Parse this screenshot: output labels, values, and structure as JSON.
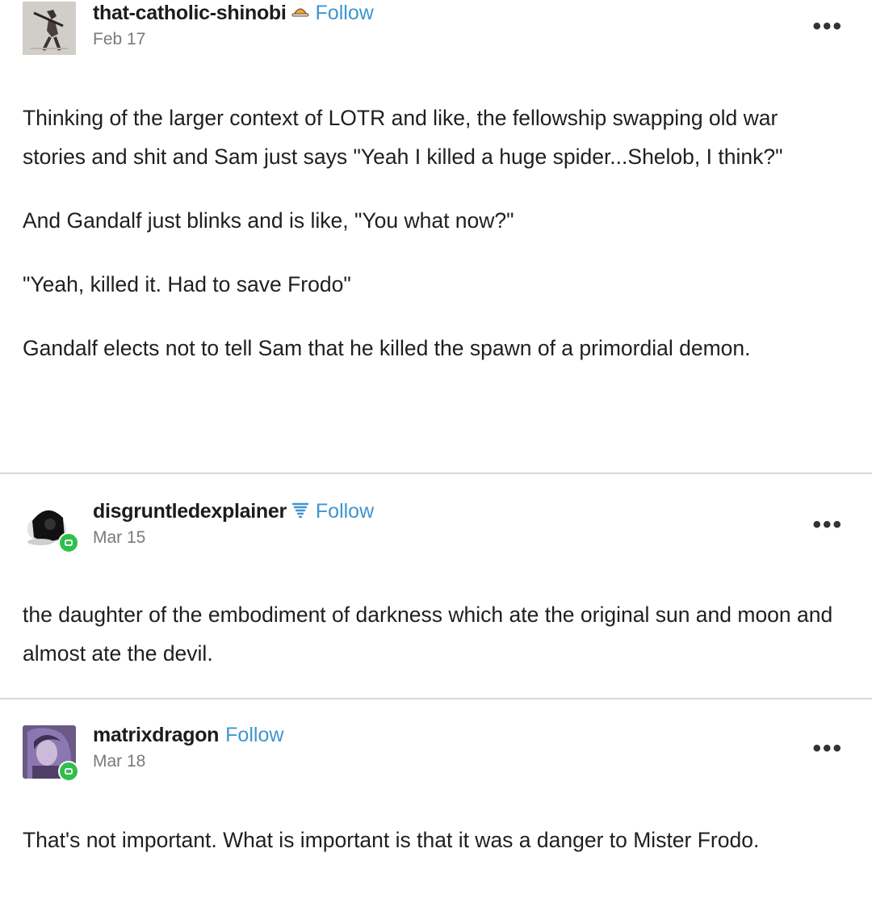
{
  "posts": [
    {
      "username": "that-catholic-shinobi",
      "badge_icon": "hat-icon",
      "follow_label": "Follow",
      "date": "Feb 17",
      "more_label": "•••",
      "paragraphs": [
        "Thinking of the larger context of LOTR and like, the fellowship swapping old war stories and shit and Sam just says \"Yeah I killed a huge spider...Shelob, I think?\"",
        "And Gandalf just blinks and is like, \"You what now?\"",
        "\"Yeah, killed it. Had to save Frodo\"",
        "Gandalf elects not to tell Sam that he killed the spawn of a primordial demon."
      ]
    },
    {
      "username": "disgruntledexplainer",
      "badge_icon": "tornado-icon",
      "follow_label": "Follow",
      "date": "Mar 15",
      "more_label": "•••",
      "paragraphs": [
        "the daughter of the embodiment of darkness which ate the original sun and moon and almost ate the devil."
      ]
    },
    {
      "username": "matrixdragon",
      "follow_label": "Follow",
      "date": "Mar 18",
      "more_label": "•••",
      "paragraphs": [
        "That's not important. What is important is that it was a danger to Mister Frodo."
      ]
    }
  ],
  "colors": {
    "follow": "#3f95cf",
    "reblog_badge": "#2fbf4d",
    "divider": "#d9d9d9"
  }
}
